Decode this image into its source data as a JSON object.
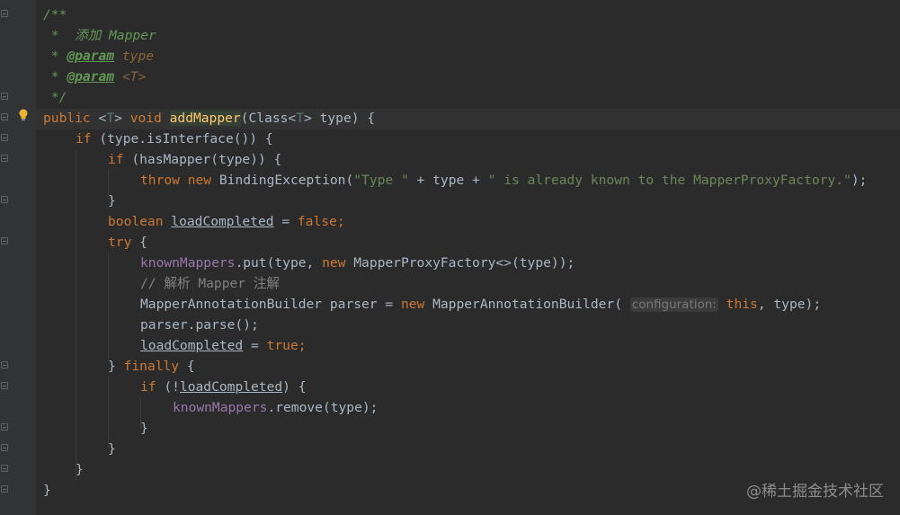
{
  "code": {
    "l1": "/**",
    "l2_star": " *  ",
    "l2_text": "添加 Mapper",
    "l3_star": " * ",
    "l3_tag": "@param",
    "l3_sp": " ",
    "l3_type": "type",
    "l4_star": " * ",
    "l4_tag": "@param",
    "l4_sp": " ",
    "l4_type": "<T>",
    "l5": " */",
    "l6_public": "public ",
    "l6_lt": "<",
    "l6_T": "T",
    "l6_gt": "> ",
    "l6_void": "void ",
    "l6_name": "addMapper",
    "l6_p1": "(Class<",
    "l6_T2": "T",
    "l6_p2": "> type) {",
    "l7_if": "if ",
    "l7_rest": "(type.isInterface()) {",
    "l8_if": "if ",
    "l8_rest": "(hasMapper(type)) {",
    "l9_throw": "throw ",
    "l9_new": "new ",
    "l9_cls": "BindingException(",
    "l9_s1": "\"Type \"",
    "l9_plus1": " + type + ",
    "l9_s2": "\" is already known to the MapperProxyFactory.\"",
    "l9_end": ");",
    "l10": "}",
    "l11_bool": "boolean ",
    "l11_var": "loadCompleted",
    "l11_eq": " = ",
    "l11_false": "false",
    "l11_semi": ";",
    "l12_try": "try ",
    "l12_brace": "{",
    "l13_field": "knownMappers",
    "l13_mid": ".put(type, ",
    "l13_new": "new ",
    "l13_end": "MapperProxyFactory<>(type));",
    "l14_comment": "// 解析 Mapper 注解",
    "l15_a": "MapperAnnotationBuilder parser = ",
    "l15_new": "new ",
    "l15_b": "MapperAnnotationBuilder( ",
    "l15_hint": "configuration:",
    "l15_sp": " ",
    "l15_this": "this",
    "l15_c": ", type);",
    "l16": "parser.parse();",
    "l17_var": "loadCompleted",
    "l17_eq": " = ",
    "l17_true": "true",
    "l17_semi": ";",
    "l18_close": "} ",
    "l18_finally": "finally ",
    "l18_brace": "{",
    "l19_if": "if ",
    "l19_p": "(!",
    "l19_var": "loadCompleted",
    "l19_end": ") {",
    "l20_field": "knownMappers",
    "l20_end": ".remove(type);",
    "l21": "}",
    "l22": "}",
    "l23": "}",
    "l24": "}"
  },
  "gutter": {
    "bulb_icon": "lightbulb-icon",
    "fold_icon": "fold-marker-icon"
  },
  "watermark": "@稀土掘金技术社区",
  "colors": {
    "background": "#2b2b2b",
    "gutter": "#313335",
    "keyword": "#cc7832",
    "method": "#ffc66d",
    "string": "#6a8759",
    "field": "#9876aa",
    "doc_comment": "#629755",
    "line_comment": "#808080",
    "type_param": "#507874"
  }
}
